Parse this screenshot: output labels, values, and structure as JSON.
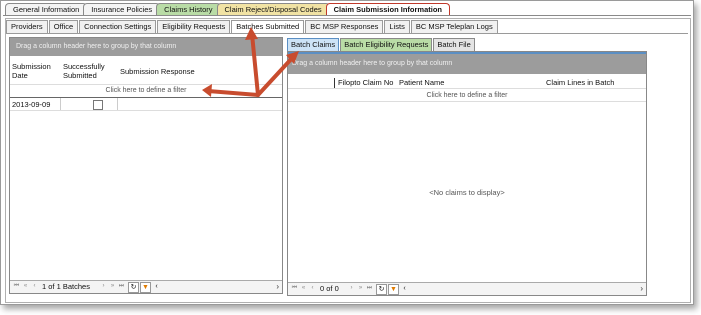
{
  "main_tabs": [
    {
      "label": "General Information"
    },
    {
      "label": "Insurance Policies"
    },
    {
      "label": "Claims History"
    },
    {
      "label": "Claim Reject/Disposal Codes"
    },
    {
      "label": "Claim Submission Information"
    }
  ],
  "sub_tabs": [
    {
      "label": "Providers"
    },
    {
      "label": "Office"
    },
    {
      "label": "Connection Settings"
    },
    {
      "label": "Eligibility Requests"
    },
    {
      "label": "Batches Submitted"
    },
    {
      "label": "BC MSP Responses"
    },
    {
      "label": "Lists"
    },
    {
      "label": "BC MSP Teleplan Logs"
    }
  ],
  "left_grid": {
    "group_hint": "Drag a column header here to group by that column",
    "columns": {
      "date": "Submission Date",
      "date_line1": "Submission",
      "date_line2": "Date",
      "success_line1": "Successfully",
      "success_line2": "Submitted",
      "response": "Submission Response"
    },
    "filter_hint": "Click here to define a filter",
    "rows": [
      {
        "date": "2013-09-09",
        "successfully_submitted": false,
        "response": ""
      }
    ],
    "pager_text": "1 of 1 Batches"
  },
  "right_tabs": [
    {
      "label": "Batch Claims"
    },
    {
      "label": "Batch Eligibility Requests"
    },
    {
      "label": "Batch File"
    }
  ],
  "right_grid": {
    "group_hint": "Drag a column header here to group by that column",
    "columns": [
      "Filopto Claim No",
      "Patient Name",
      "Claim Lines in Batch"
    ],
    "filter_hint": "Click here to define a filter",
    "empty_text": "<No claims to display>",
    "pager_text": "0 of 0"
  },
  "colors": {
    "annotation_arrow": "#c84c2e",
    "active_main_tab_border": "#c0392b",
    "claims_history_tab": "#b9dca6",
    "reject_codes_tab": "#f1e3a4",
    "batch_claims_tab": "#cde3f6"
  }
}
